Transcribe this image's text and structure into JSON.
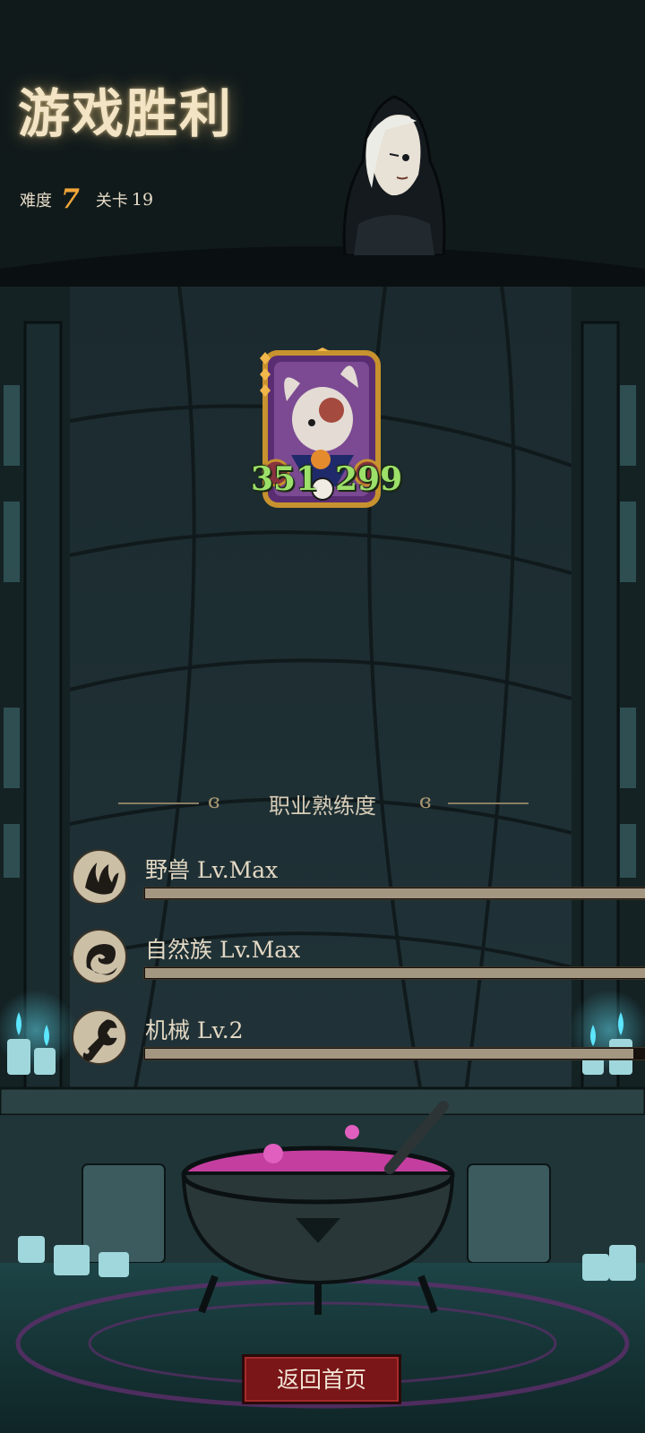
{
  "header": {
    "title": "游戏胜利",
    "difficulty_label": "难度",
    "difficulty_value": "7",
    "level_label": "关卡",
    "level_value": "19"
  },
  "card": {
    "attack": "351",
    "health": "299"
  },
  "proficiency": {
    "title": "职业熟练度",
    "items": [
      {
        "name": "野兽",
        "level": "Lv.Max",
        "progress": 1.0,
        "icon": "beast-claw-icon"
      },
      {
        "name": "自然族",
        "level": "Lv.Max",
        "progress": 1.0,
        "icon": "nature-swirl-icon"
      },
      {
        "name": "机械",
        "level": "Lv.2",
        "progress": 0.97,
        "icon": "wrench-icon"
      }
    ]
  },
  "footer": {
    "home_button": "返回首页"
  },
  "colors": {
    "accent_difficulty": "#f0a63a",
    "stat_green": "#9ce06a",
    "button_red": "#7a1518",
    "bar_fill": "#a49782"
  }
}
